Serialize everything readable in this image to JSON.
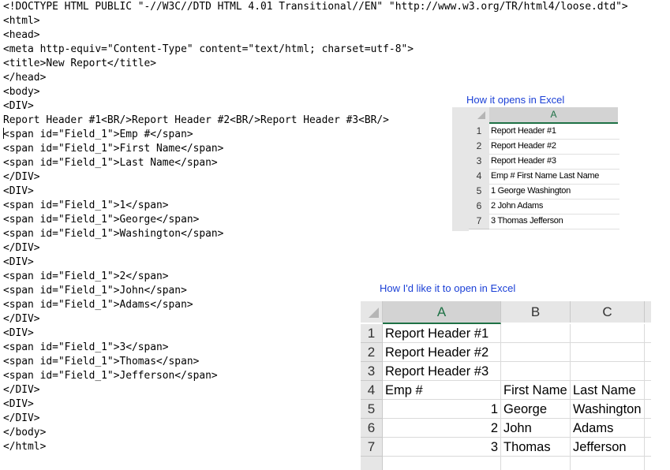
{
  "code_lines": [
    "<!DOCTYPE HTML PUBLIC \"-//W3C//DTD HTML 4.01 Transitional//EN\" \"http://www.w3.org/TR/html4/loose.dtd\">",
    "<html>",
    "<head>",
    "<meta http-equiv=\"Content-Type\" content=\"text/html; charset=utf-8\">",
    "<title>New Report</title>",
    "</head>",
    "<body>",
    "<DIV>",
    "Report Header #1<BR/>Report Header #2<BR/>Report Header #3<BR/>",
    "<span id=\"Field_1\">Emp #</span>",
    "<span id=\"Field_1\">First Name</span>",
    "<span id=\"Field_1\">Last Name</span>",
    "</DIV>",
    "<DIV>",
    "<span id=\"Field_1\">1</span>",
    "<span id=\"Field_1\">George</span>",
    "<span id=\"Field_1\">Washington</span>",
    "</DIV>",
    "<DIV>",
    "<span id=\"Field_1\">2</span>",
    "<span id=\"Field_1\">John</span>",
    "<span id=\"Field_1\">Adams</span>",
    "</DIV>",
    "<DIV>",
    "<span id=\"Field_1\">3</span>",
    "<span id=\"Field_1\">Thomas</span>",
    "<span id=\"Field_1\">Jefferson</span>",
    "</DIV>",
    "<DIV>",
    "</DIV>",
    "</body>",
    "</html>"
  ],
  "caption_current": "How it opens in Excel",
  "caption_desired": "How I'd like it to open in Excel",
  "excel_small": {
    "column_header": "A",
    "rows": [
      {
        "num": "1",
        "value": "Report Header #1"
      },
      {
        "num": "2",
        "value": "Report Header #2"
      },
      {
        "num": "3",
        "value": "Report Header #3"
      },
      {
        "num": "4",
        "value": "Emp # First Name Last Name"
      },
      {
        "num": "5",
        "value": "1 George Washington"
      },
      {
        "num": "6",
        "value": "2 John Adams"
      },
      {
        "num": "7",
        "value": "3 Thomas Jefferson"
      }
    ]
  },
  "excel_big": {
    "column_headers": [
      "A",
      "B",
      "C"
    ],
    "rows": [
      {
        "num": "1",
        "a": "Report Header #1",
        "b": "",
        "c": ""
      },
      {
        "num": "2",
        "a": "Report Header #2",
        "b": "",
        "c": ""
      },
      {
        "num": "3",
        "a": "Report Header #3",
        "b": "",
        "c": ""
      },
      {
        "num": "4",
        "a": "Emp #",
        "b": "First Name",
        "c": "Last Name"
      },
      {
        "num": "5",
        "a": "1",
        "b": "George",
        "c": "Washington"
      },
      {
        "num": "6",
        "a": "2",
        "b": "John",
        "c": "Adams"
      },
      {
        "num": "7",
        "a": "3",
        "b": "Thomas",
        "c": "Jefferson"
      }
    ]
  },
  "colors": {
    "caption": "#1a3fd6",
    "excel_selected_header": "#1e7145"
  }
}
